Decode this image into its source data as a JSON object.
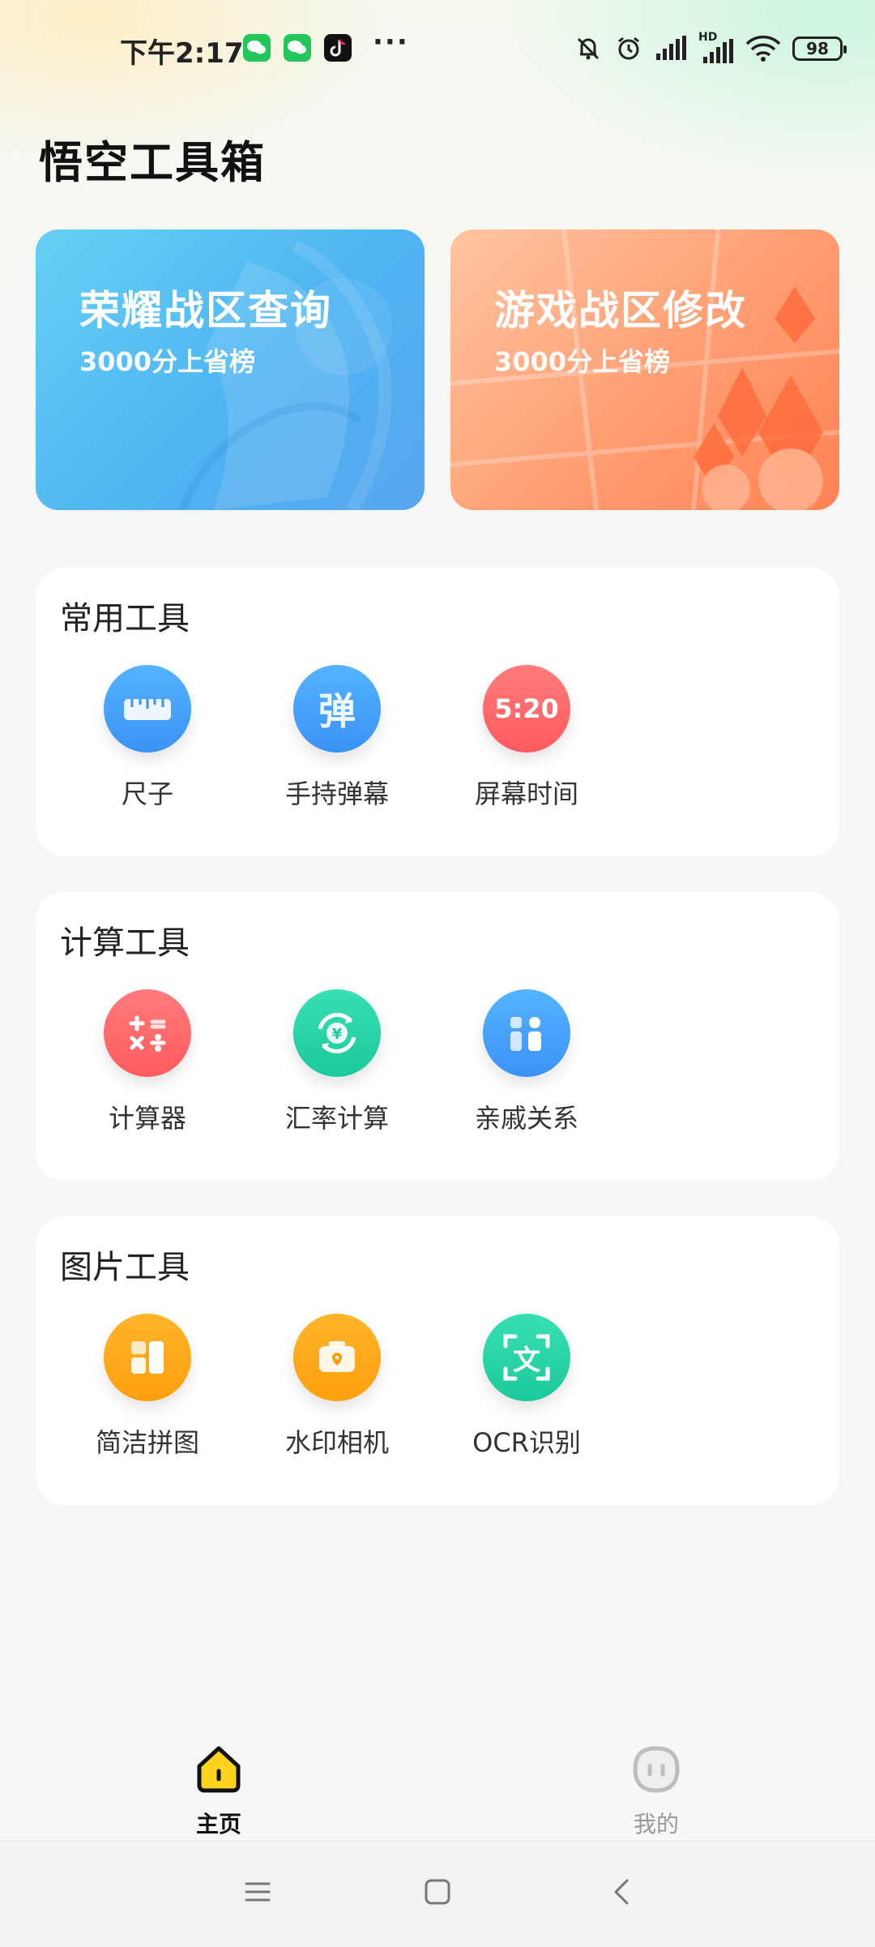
{
  "status_bar": {
    "time": "下午2:17",
    "battery": "98"
  },
  "app_title": "悟空工具箱",
  "banners": [
    {
      "title": "荣耀战区查询",
      "subtitle": "3000分上省榜"
    },
    {
      "title": "游戏战区修改",
      "subtitle": "3000分上省榜"
    }
  ],
  "sections": [
    {
      "title": "常用工具",
      "tools": [
        {
          "label": "尺子",
          "icon": "ruler-icon"
        },
        {
          "label": "手持弹幕",
          "icon": "bullet-screen-icon",
          "glyph": "弹"
        },
        {
          "label": "屏幕时间",
          "icon": "screen-time-icon",
          "glyph": "5:20"
        }
      ]
    },
    {
      "title": "计算工具",
      "tools": [
        {
          "label": "计算器",
          "icon": "calculator-icon"
        },
        {
          "label": "汇率计算",
          "icon": "exchange-rate-icon"
        },
        {
          "label": "亲戚关系",
          "icon": "relatives-icon"
        }
      ]
    },
    {
      "title": "图片工具",
      "tools": [
        {
          "label": "简洁拼图",
          "icon": "collage-icon"
        },
        {
          "label": "水印相机",
          "icon": "watermark-camera-icon"
        },
        {
          "label": "OCR识别",
          "icon": "ocr-icon",
          "glyph": "文"
        }
      ]
    }
  ],
  "bottom_nav": [
    {
      "label": "主页",
      "icon": "home-icon",
      "active": true
    },
    {
      "label": "我的",
      "icon": "profile-icon",
      "active": false
    }
  ],
  "colors": {
    "blue": "#4ea7f6",
    "red": "#ff6466",
    "green": "#2ad8a8",
    "orange": "#ffa61a",
    "accent_yellow": "#ffd21f"
  }
}
